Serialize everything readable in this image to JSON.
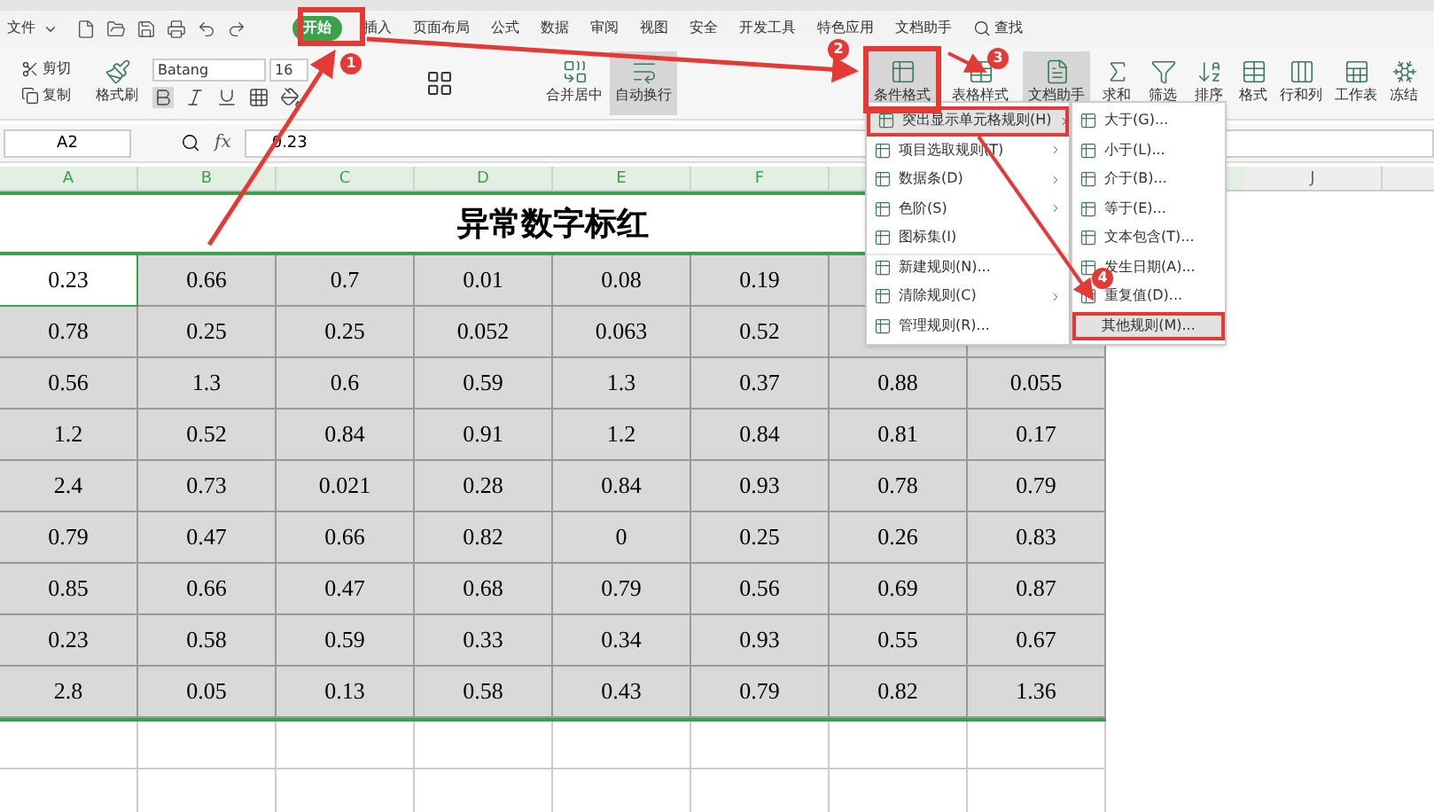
{
  "menu_bar": {
    "file_label": "文件",
    "tabs": [
      {
        "label": "开始",
        "selected": true
      },
      {
        "label": "插入",
        "selected": false
      },
      {
        "label": "页面布局",
        "selected": false
      },
      {
        "label": "公式",
        "selected": false
      },
      {
        "label": "数据",
        "selected": false
      },
      {
        "label": "审阅",
        "selected": false
      },
      {
        "label": "视图",
        "selected": false
      },
      {
        "label": "安全",
        "selected": false
      },
      {
        "label": "开发工具",
        "selected": false
      },
      {
        "label": "特色应用",
        "selected": false
      },
      {
        "label": "文档助手",
        "selected": false
      }
    ],
    "search_label": "查找"
  },
  "ribbon": {
    "clipboard": [
      "剪切",
      "复制"
    ],
    "format_painter": "格式刷",
    "font_name": "Batang",
    "font_size": "16",
    "merge_label": "合并居中",
    "wrap_label": "自动换行",
    "conditional_format": "条件格式",
    "table_style": "表格样式",
    "doc_assistant": "文档助手",
    "tools": [
      "求和",
      "筛选",
      "排序",
      "格式",
      "行和列",
      "工作表",
      "冻结"
    ]
  },
  "formula_bar": {
    "cell_ref": "A2",
    "fx_label": "fx",
    "value": "0.23"
  },
  "columns": [
    {
      "label": "A",
      "selected": true
    },
    {
      "label": "B",
      "selected": true
    },
    {
      "label": "C",
      "selected": true
    },
    {
      "label": "D",
      "selected": true
    },
    {
      "label": "E",
      "selected": true
    },
    {
      "label": "F",
      "selected": true
    }
  ],
  "columns_right": [
    {
      "label": "J",
      "selected": false
    }
  ],
  "sheet_title": "异常数字标红",
  "rows": [
    {
      "cells": [
        {
          "text": "0.23",
          "selected": true
        },
        {
          "text": "0.66",
          "selected": false
        },
        {
          "text": "0.7",
          "selected": false
        },
        {
          "text": "0.01",
          "selected": false
        },
        {
          "text": "0.08",
          "selected": false
        },
        {
          "text": "0.19",
          "selected": false
        }
      ]
    },
    {
      "cells": [
        {
          "text": "0.78",
          "selected": false
        },
        {
          "text": "0.25",
          "selected": false
        },
        {
          "text": "0.25",
          "selected": false
        },
        {
          "text": "0.052",
          "selected": false
        },
        {
          "text": "0.063",
          "selected": false
        },
        {
          "text": "0.52",
          "selected": false
        }
      ]
    },
    {
      "cells": [
        {
          "text": "0.56",
          "selected": false
        },
        {
          "text": "1.3",
          "selected": false
        },
        {
          "text": "0.6",
          "selected": false
        },
        {
          "text": "0.59",
          "selected": false
        },
        {
          "text": "1.3",
          "selected": false
        },
        {
          "text": "0.37",
          "selected": false
        },
        {
          "text": "0.88",
          "selected": false
        },
        {
          "text": "0.055",
          "selected": false
        }
      ]
    },
    {
      "cells": [
        {
          "text": "1.2",
          "selected": false
        },
        {
          "text": "0.52",
          "selected": false
        },
        {
          "text": "0.84",
          "selected": false
        },
        {
          "text": "0.91",
          "selected": false
        },
        {
          "text": "1.2",
          "selected": false
        },
        {
          "text": "0.84",
          "selected": false
        },
        {
          "text": "0.81",
          "selected": false
        },
        {
          "text": "0.17",
          "selected": false
        }
      ]
    },
    {
      "cells": [
        {
          "text": "2.4",
          "selected": false
        },
        {
          "text": "0.73",
          "selected": false
        },
        {
          "text": "0.021",
          "selected": false
        },
        {
          "text": "0.28",
          "selected": false
        },
        {
          "text": "0.84",
          "selected": false
        },
        {
          "text": "0.93",
          "selected": false
        },
        {
          "text": "0.78",
          "selected": false
        },
        {
          "text": "0.79",
          "selected": false
        }
      ]
    },
    {
      "cells": [
        {
          "text": "0.79",
          "selected": false
        },
        {
          "text": "0.47",
          "selected": false
        },
        {
          "text": "0.66",
          "selected": false
        },
        {
          "text": "0.82",
          "selected": false
        },
        {
          "text": "0",
          "selected": false
        },
        {
          "text": "0.25",
          "selected": false
        },
        {
          "text": "0.26",
          "selected": false
        },
        {
          "text": "0.83",
          "selected": false
        }
      ]
    },
    {
      "cells": [
        {
          "text": "0.85",
          "selected": false
        },
        {
          "text": "0.66",
          "selected": false
        },
        {
          "text": "0.47",
          "selected": false
        },
        {
          "text": "0.68",
          "selected": false
        },
        {
          "text": "0.79",
          "selected": false
        },
        {
          "text": "0.56",
          "selected": false
        },
        {
          "text": "0.69",
          "selected": false
        },
        {
          "text": "0.87",
          "selected": false
        }
      ]
    },
    {
      "cells": [
        {
          "text": "0.23",
          "selected": false
        },
        {
          "text": "0.58",
          "selected": false
        },
        {
          "text": "0.59",
          "selected": false
        },
        {
          "text": "0.33",
          "selected": false
        },
        {
          "text": "0.34",
          "selected": false
        },
        {
          "text": "0.93",
          "selected": false
        },
        {
          "text": "0.55",
          "selected": false
        },
        {
          "text": "0.67",
          "selected": false
        }
      ]
    },
    {
      "cells": [
        {
          "text": "2.8",
          "selected": false
        },
        {
          "text": "0.05",
          "selected": false
        },
        {
          "text": "0.13",
          "selected": false
        },
        {
          "text": "0.58",
          "selected": false
        },
        {
          "text": "0.43",
          "selected": false
        },
        {
          "text": "0.79",
          "selected": false
        },
        {
          "text": "0.82",
          "selected": false
        },
        {
          "text": "1.36",
          "selected": false
        }
      ]
    }
  ],
  "menu": [
    {
      "label": "突出显示单元格规则(H)",
      "submenu": true,
      "selected": true
    },
    {
      "label": "项目选取规则(T)",
      "submenu": true,
      "selected": false
    },
    {
      "label": "数据条(D)",
      "submenu": true,
      "selected": false
    },
    {
      "label": "色阶(S)",
      "submenu": true,
      "selected": false
    },
    {
      "label": "图标集(I)",
      "submenu": false,
      "selected": false
    },
    {
      "label": "新建规则(N)...",
      "submenu": false,
      "selected": false
    },
    {
      "label": "清除规则(C)",
      "submenu": true,
      "selected": false
    },
    {
      "label": "管理规则(R)...",
      "submenu": false,
      "selected": false
    }
  ],
  "submenu": [
    {
      "label": "大于(G)...",
      "selected": false
    },
    {
      "label": "小于(L)...",
      "selected": false
    },
    {
      "label": "介于(B)...",
      "selected": false
    },
    {
      "label": "等于(E)...",
      "selected": false
    },
    {
      "label": "文本包含(T)...",
      "selected": false
    },
    {
      "label": "发生日期(A)...",
      "selected": false
    },
    {
      "label": "重复值(D)...",
      "selected": false
    },
    {
      "label": "其他规则(M)...",
      "selected": true
    }
  ],
  "step_badges": [
    "1",
    "2",
    "3",
    "4"
  ]
}
